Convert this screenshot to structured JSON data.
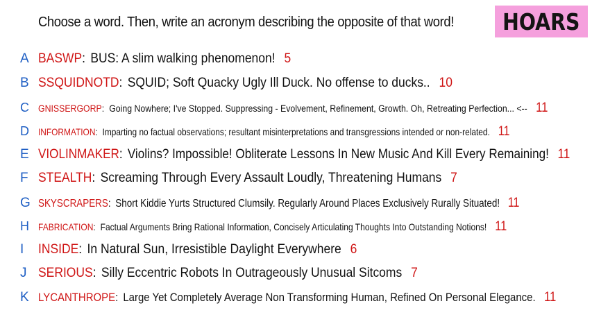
{
  "prompt": "Choose a word. Then, write an acronym describing the opposite of that word!",
  "badge": "HOARS",
  "entries": [
    {
      "letter": "A",
      "word": "BASWP",
      "definition": "BUS: A slim walking phenomenon!",
      "score": "5"
    },
    {
      "letter": "B",
      "word": "SSQUIDNOTD",
      "definition": "SQUID; Soft Quacky Ugly Ill Duck. No offense to ducks..",
      "score": "10"
    },
    {
      "letter": "C",
      "word": "GNISSERGORP",
      "definition": "Going Nowhere; I've Stopped. Suppressing - Evolvement, Refinement, Growth. Oh, Retreating Perfection... <--",
      "score": "11"
    },
    {
      "letter": "D",
      "word": "INFORMATION",
      "definition": "Imparting no factual observations; resultant misinterpretations and transgressions intended or non-related.",
      "score": "11"
    },
    {
      "letter": "E",
      "word": "VIOLINMAKER",
      "definition": "Violins? Impossible! Obliterate Lessons In New Music And Kill Every Remaining!",
      "score": "11"
    },
    {
      "letter": "F",
      "word": "STEALTH",
      "definition": "Screaming Through Every Assault Loudly, Threatening Humans",
      "score": "7"
    },
    {
      "letter": "G",
      "word": "SKYSCRAPERS",
      "definition": "Short Kiddie Yurts Structured Clumsily. Regularly Around Places Exclusively Rurally Situated!",
      "score": "11"
    },
    {
      "letter": "H",
      "word": "FABRICATION",
      "definition": "Factual Arguments Bring Rational Information, Concisely Articulating Thoughts Into Outstanding Notions!",
      "score": "11"
    },
    {
      "letter": "I",
      "word": "INSIDE",
      "definition": "In Natural Sun, Irresistible Daylight Everywhere",
      "score": "6"
    },
    {
      "letter": "J",
      "word": "SERIOUS",
      "definition": "Silly Eccentric Robots In Outrageously Unusual Sitcoms",
      "score": "7"
    },
    {
      "letter": "K",
      "word": "LYCANTHROPE",
      "definition": "Large Yet Completely Average Non Transforming Human, Refined On Personal Elegance.",
      "score": "11"
    }
  ]
}
